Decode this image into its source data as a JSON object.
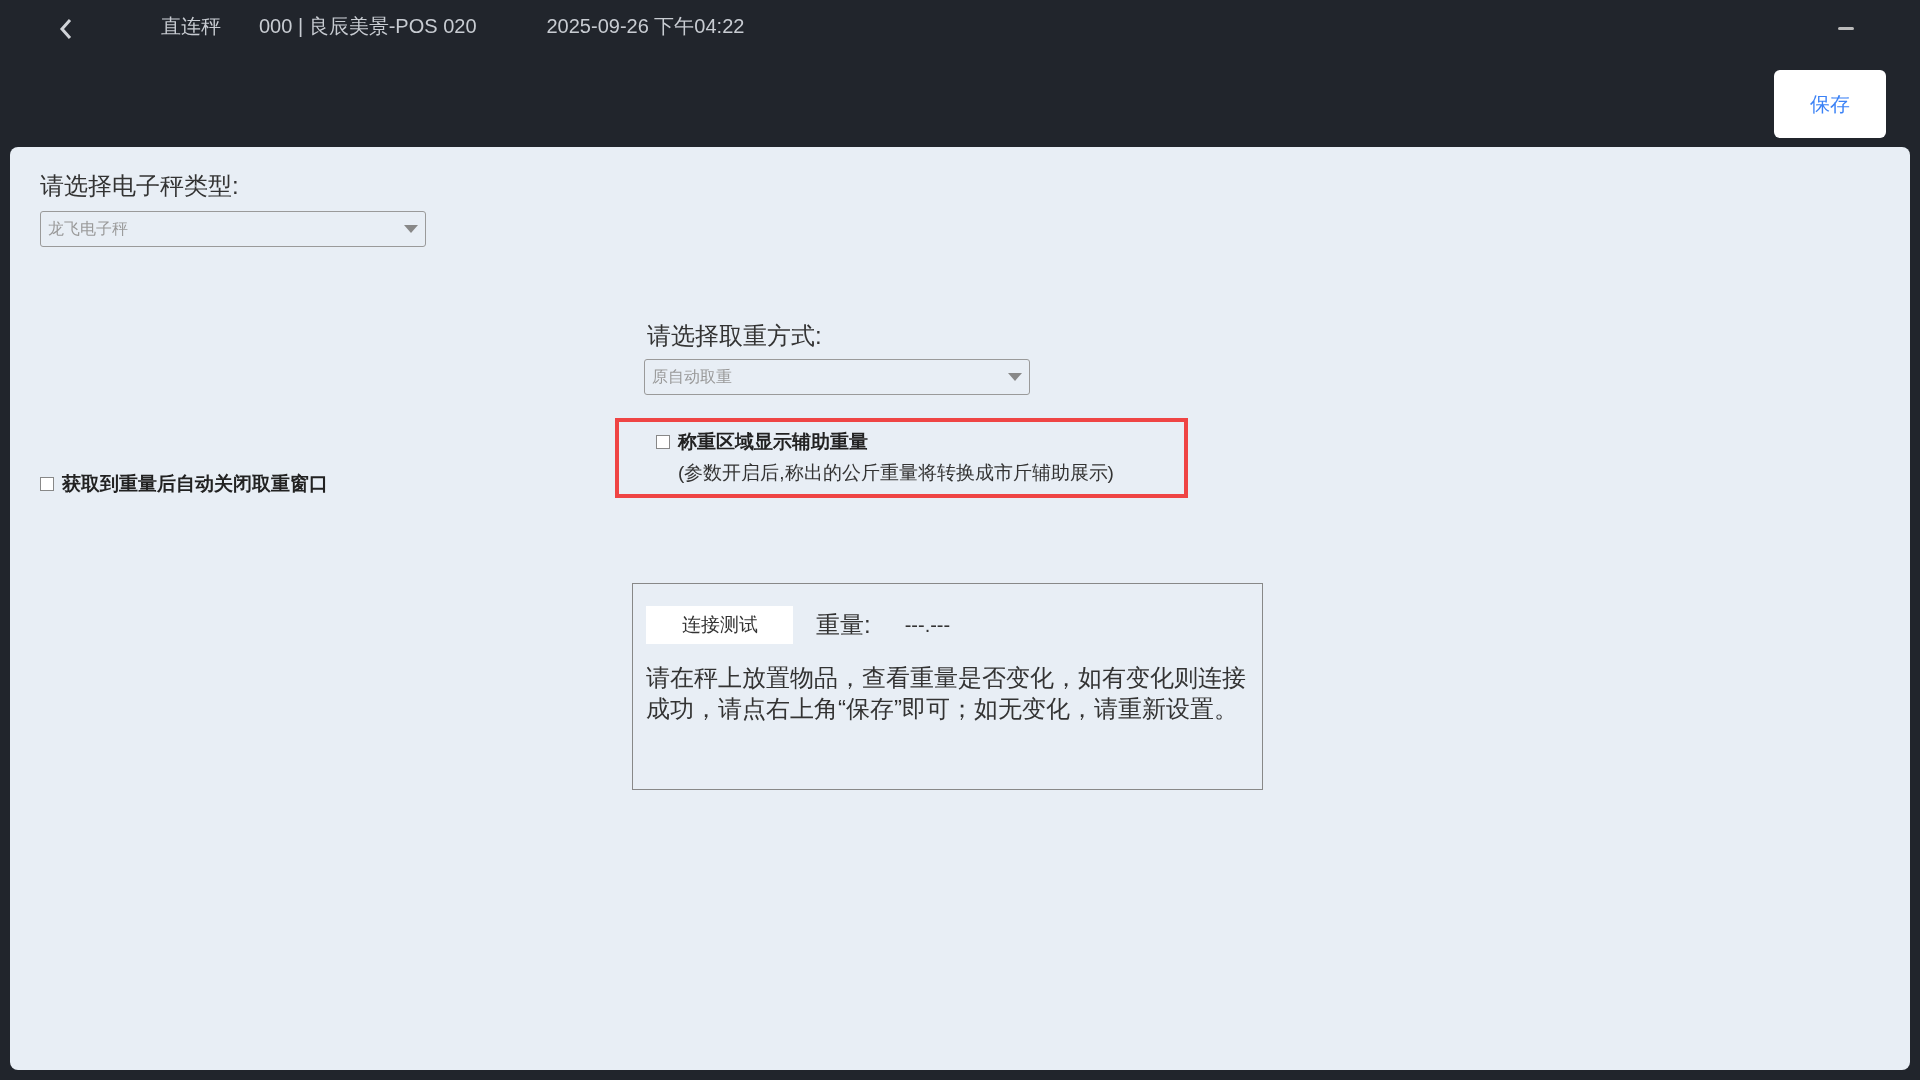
{
  "header": {
    "title": "直连秤",
    "store": "000 | 良辰美景-POS 020",
    "datetime": "2025-09-26 下午04:22"
  },
  "save_button": "保存",
  "scale_type": {
    "label": "请选择电子秤类型:",
    "value": "龙飞电子秤"
  },
  "weigh_mode": {
    "label": "请选择取重方式:",
    "value": "原自动取重"
  },
  "options": [
    {
      "label": "获取到重量后自动关闭取重窗口",
      "checked": false
    },
    {
      "label": "称重区域显示辅助重量",
      "note": "(参数开启后,称出的公斤重量将转换成市斤辅助展示)",
      "checked": false
    }
  ],
  "test": {
    "button": "连接测试",
    "weight_label": "重量:",
    "weight_value": "---.---",
    "instructions": "请在秤上放置物品，查看重量是否变化，如有变化则连接成功，请点右上角“保存”即可；如无变化，请重新设置。"
  }
}
